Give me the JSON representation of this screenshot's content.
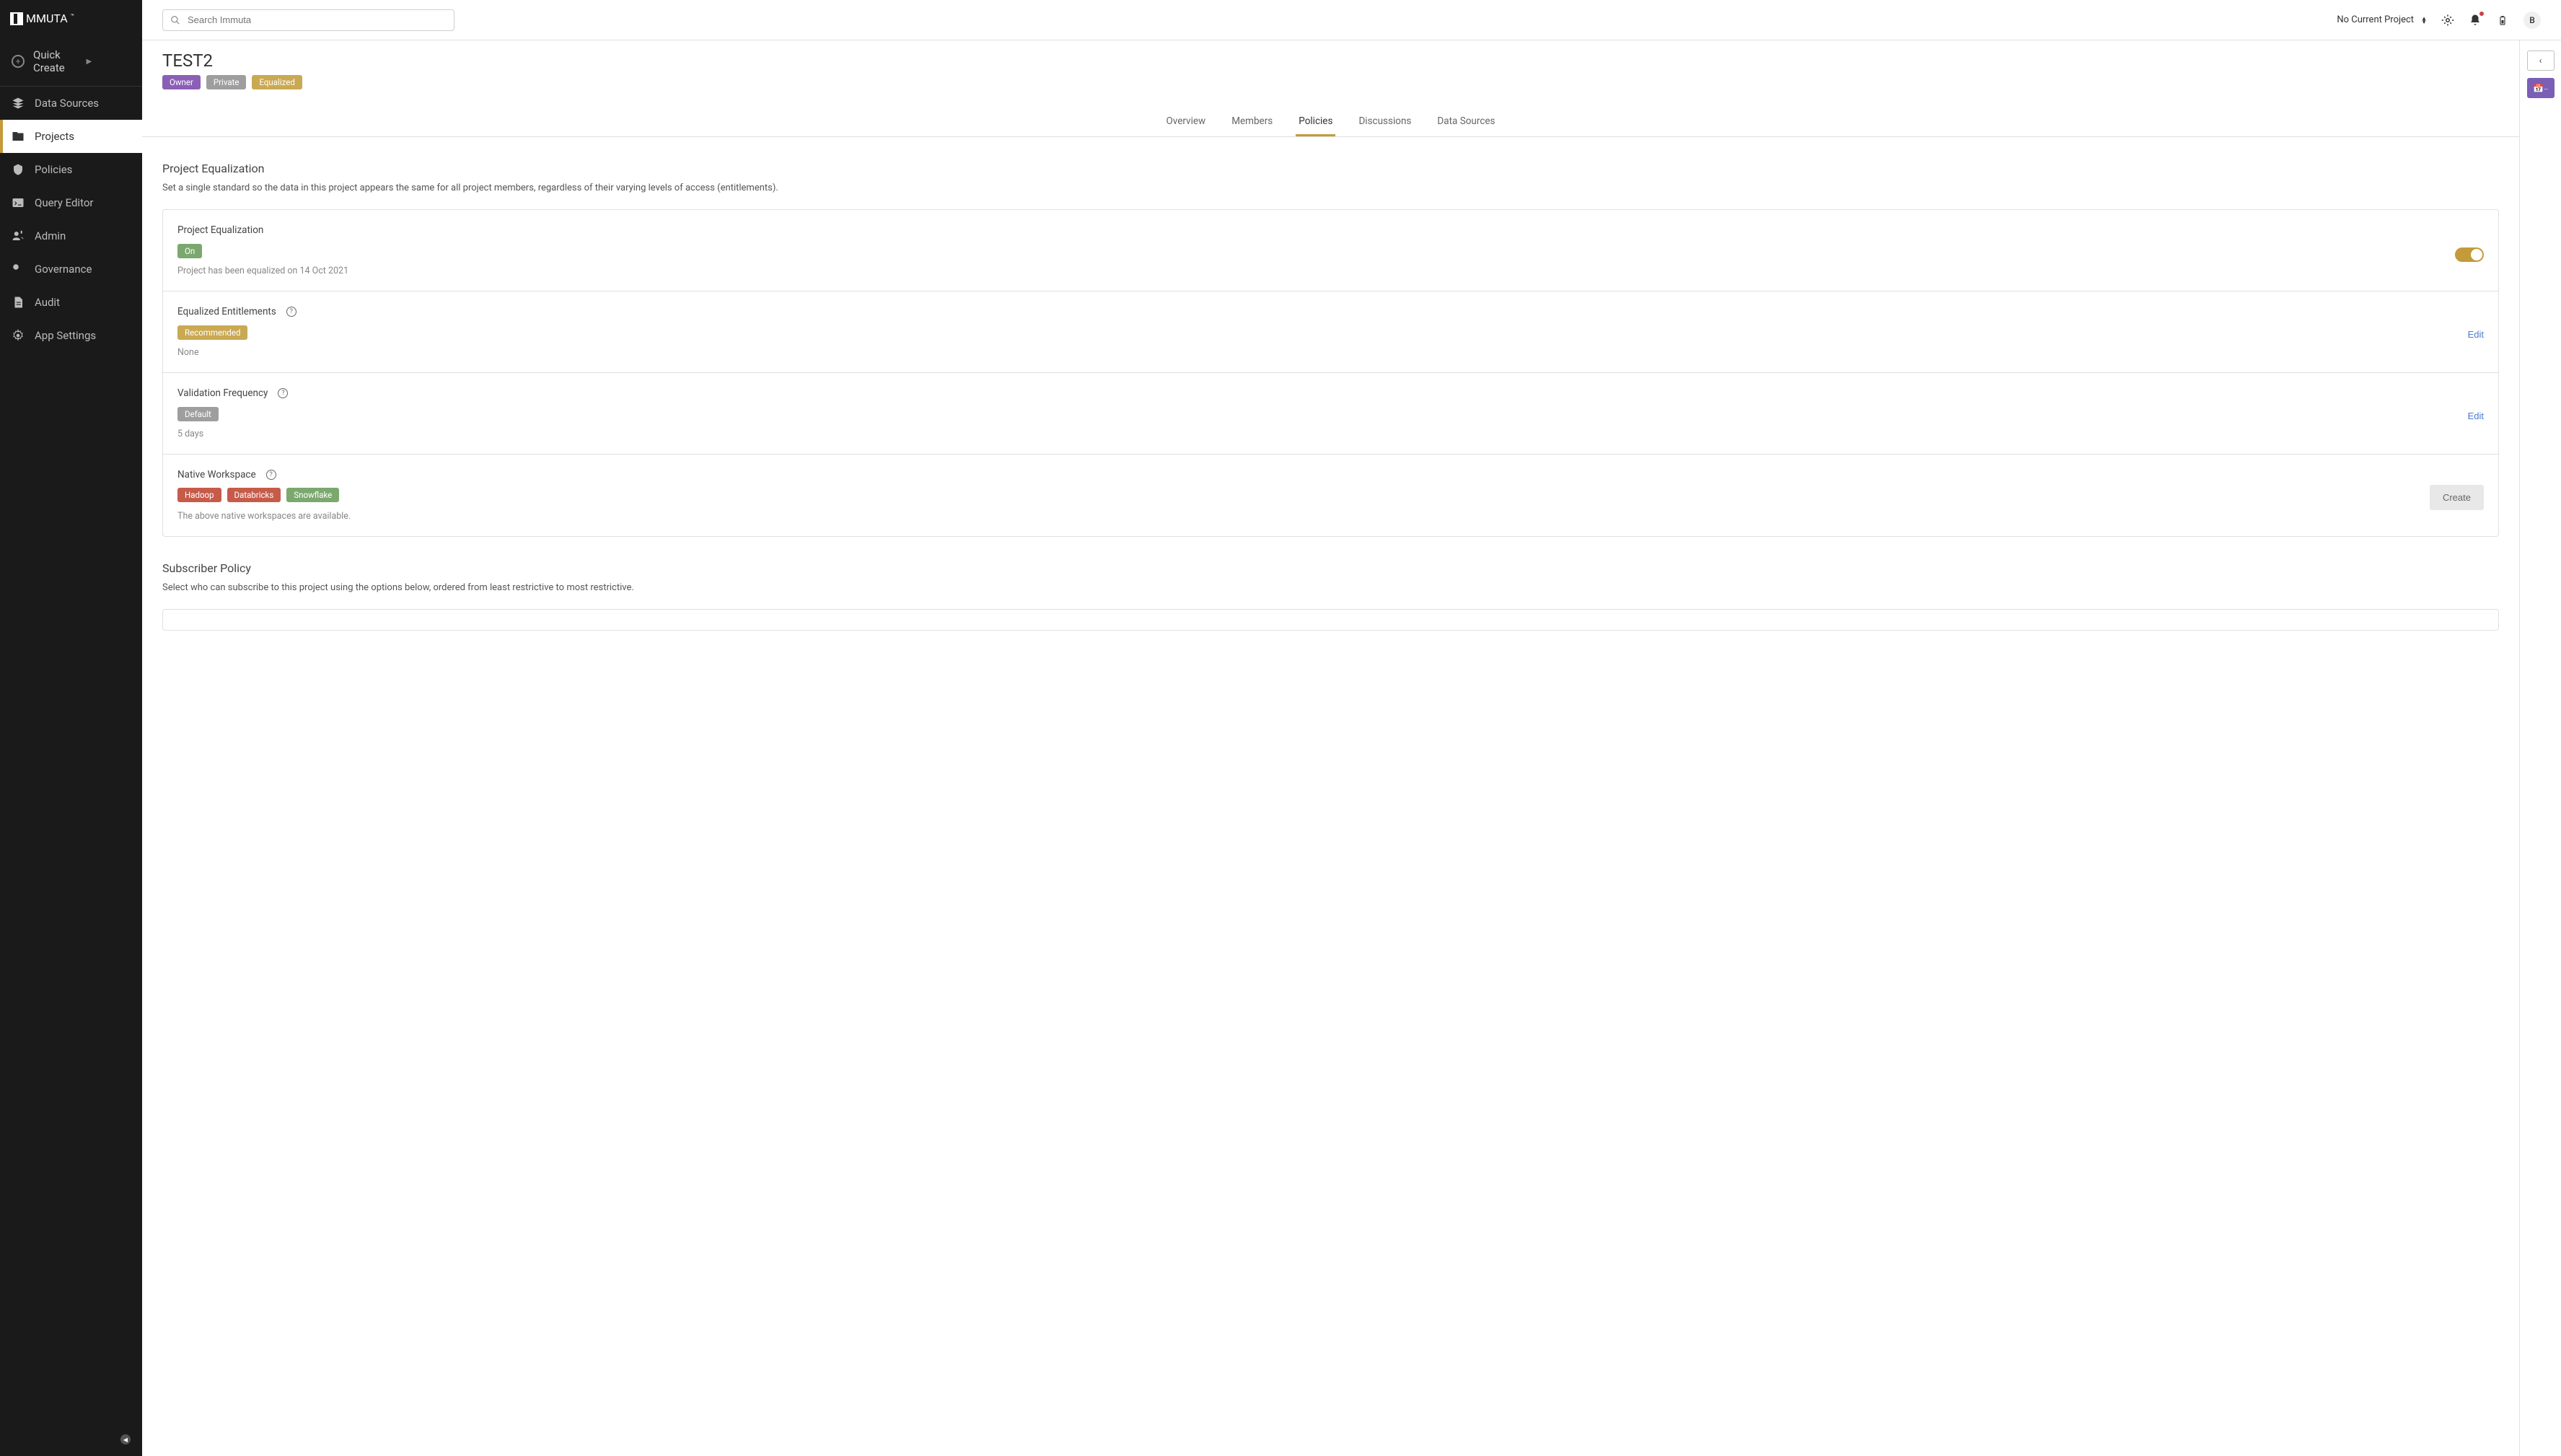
{
  "logo": "MMUTA",
  "quickCreate": {
    "label": "Quick Create"
  },
  "sidebar": {
    "items": [
      {
        "label": "Data Sources",
        "icon": "layers"
      },
      {
        "label": "Projects",
        "icon": "folder",
        "active": true
      },
      {
        "label": "Policies",
        "icon": "shield"
      },
      {
        "label": "Query Editor",
        "icon": "terminal"
      },
      {
        "label": "Admin",
        "icon": "users"
      },
      {
        "label": "Governance",
        "icon": "key"
      },
      {
        "label": "Audit",
        "icon": "doc"
      },
      {
        "label": "App Settings",
        "icon": "gear"
      }
    ]
  },
  "search": {
    "placeholder": "Search Immuta"
  },
  "header": {
    "projectSelector": "No Current Project",
    "avatarInitial": "B"
  },
  "page": {
    "title": "TEST2",
    "badges": [
      {
        "label": "Owner",
        "cls": "owner"
      },
      {
        "label": "Private",
        "cls": "private"
      },
      {
        "label": "Equalized",
        "cls": "equalized"
      }
    ]
  },
  "tabs": [
    {
      "label": "Overview"
    },
    {
      "label": "Members"
    },
    {
      "label": "Policies",
      "active": true
    },
    {
      "label": "Discussions"
    },
    {
      "label": "Data Sources"
    }
  ],
  "equalization": {
    "title": "Project Equalization",
    "desc": "Set a single standard so the data in this project appears the same for all project members, regardless of their varying levels of access (entitlements).",
    "rows": {
      "main": {
        "title": "Project Equalization",
        "badge": "On",
        "note": "Project has been equalized on 14 Oct 2021"
      },
      "entitlements": {
        "title": "Equalized Entitlements",
        "badge": "Recommended",
        "note": "None",
        "action": "Edit"
      },
      "validation": {
        "title": "Validation Frequency",
        "badge": "Default",
        "note": "5 days",
        "action": "Edit"
      },
      "workspace": {
        "title": "Native Workspace",
        "badges": [
          {
            "label": "Hadoop",
            "cls": "hadoop"
          },
          {
            "label": "Databricks",
            "cls": "databricks"
          },
          {
            "label": "Snowflake",
            "cls": "snowflake"
          }
        ],
        "note": "The above native workspaces are available.",
        "action": "Create"
      }
    }
  },
  "subscriber": {
    "title": "Subscriber Policy",
    "desc": "Select who can subscribe to this project using the options below, ordered from least restrictive to most restrictive."
  }
}
